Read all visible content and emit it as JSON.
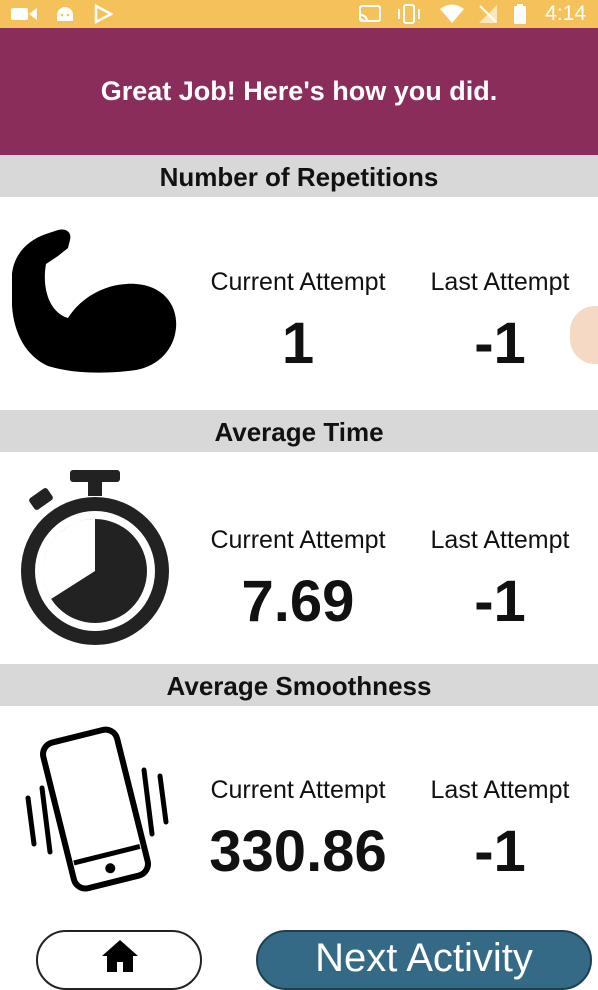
{
  "status_bar": {
    "time": "4:14",
    "icons": [
      "video-camera-icon",
      "android-icon",
      "play-store-icon",
      "cast-icon",
      "vibrate-icon",
      "wifi-icon",
      "no-signal-icon",
      "battery-icon"
    ]
  },
  "header": {
    "title": "Great Job! Here's how you did."
  },
  "sections": [
    {
      "title": "Number of Repetitions",
      "icon": "flexed-bicep-icon",
      "current_label": "Current Attempt",
      "current_value": "1",
      "last_label": "Last Attempt",
      "last_value": "-1"
    },
    {
      "title": "Average Time",
      "icon": "stopwatch-icon",
      "current_label": "Current Attempt",
      "current_value": "7.69",
      "last_label": "Last Attempt",
      "last_value": "-1"
    },
    {
      "title": "Average Smoothness",
      "icon": "vibrating-phone-icon",
      "current_label": "Current Attempt",
      "current_value": "330.86",
      "last_label": "Last Attempt",
      "last_value": "-1"
    }
  ],
  "footer": {
    "home_icon": "home-icon",
    "next_label": "Next Activity"
  },
  "colors": {
    "status_bar": "#f4c15a",
    "header": "#8b2d5b",
    "section_band": "#d8d8d8",
    "next_button": "#346a85"
  }
}
